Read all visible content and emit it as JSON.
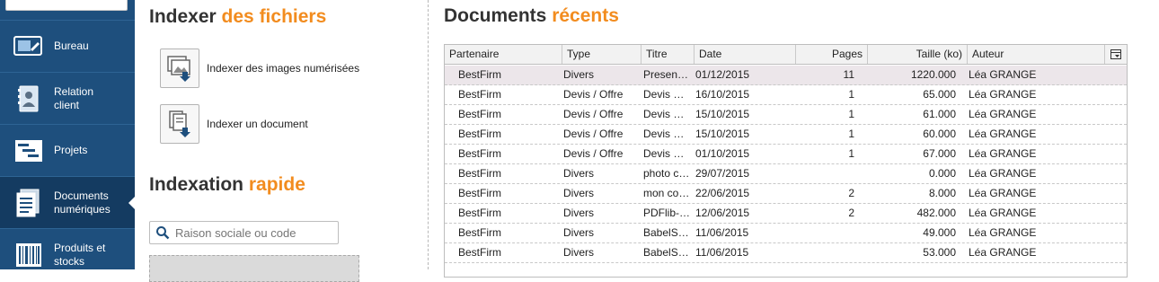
{
  "sidebar": {
    "items": [
      {
        "label": "Bureau",
        "icon": "desktop-icon"
      },
      {
        "label": "Relation\nclient",
        "icon": "contact-book-icon"
      },
      {
        "label": "Projets",
        "icon": "gantt-chart-icon"
      },
      {
        "label": "Documents\nnumériques",
        "icon": "document-icon",
        "active": true
      },
      {
        "label": "Produits et\nstocks",
        "icon": "barcode-icon"
      }
    ]
  },
  "indexer": {
    "title_main": "Indexer",
    "title_accent": "des fichiers",
    "actions": [
      {
        "label": "Indexer des images numérisées",
        "icon": "scan-images-icon"
      },
      {
        "label": "Indexer un document",
        "icon": "index-document-icon"
      }
    ]
  },
  "quick": {
    "title_main": "Indexation",
    "title_accent": "rapide",
    "search_placeholder": "Raison sociale ou code"
  },
  "recent": {
    "title_main": "Documents",
    "title_accent": "récents",
    "columns": [
      "Partenaire",
      "Type",
      "Titre",
      "Date",
      "Pages",
      "Taille (ko)",
      "Auteur"
    ],
    "rows": [
      {
        "partenaire": "BestFirm",
        "type": "Divers",
        "titre": "Presen…",
        "date": "01/12/2015",
        "pages": "11",
        "taille": "1220.000",
        "auteur": "Léa GRANGE"
      },
      {
        "partenaire": "BestFirm",
        "type": "Devis / Offre",
        "titre": "Devis …",
        "date": "16/10/2015",
        "pages": "1",
        "taille": "65.000",
        "auteur": "Léa GRANGE"
      },
      {
        "partenaire": "BestFirm",
        "type": "Devis / Offre",
        "titre": "Devis …",
        "date": "15/10/2015",
        "pages": "1",
        "taille": "61.000",
        "auteur": "Léa GRANGE"
      },
      {
        "partenaire": "BestFirm",
        "type": "Devis / Offre",
        "titre": "Devis …",
        "date": "15/10/2015",
        "pages": "1",
        "taille": "60.000",
        "auteur": "Léa GRANGE"
      },
      {
        "partenaire": "BestFirm",
        "type": "Devis / Offre",
        "titre": "Devis …",
        "date": "01/10/2015",
        "pages": "1",
        "taille": "67.000",
        "auteur": "Léa GRANGE"
      },
      {
        "partenaire": "BestFirm",
        "type": "Divers",
        "titre": "photo c…",
        "date": "29/07/2015",
        "pages": "",
        "taille": "0.000",
        "auteur": "Léa GRANGE"
      },
      {
        "partenaire": "BestFirm",
        "type": "Divers",
        "titre": "mon co…",
        "date": "22/06/2015",
        "pages": "2",
        "taille": "8.000",
        "auteur": "Léa GRANGE"
      },
      {
        "partenaire": "BestFirm",
        "type": "Divers",
        "titre": "PDFlib-…",
        "date": "12/06/2015",
        "pages": "2",
        "taille": "482.000",
        "auteur": "Léa GRANGE"
      },
      {
        "partenaire": "BestFirm",
        "type": "Divers",
        "titre": "BabelS…",
        "date": "11/06/2015",
        "pages": "",
        "taille": "49.000",
        "auteur": "Léa GRANGE"
      },
      {
        "partenaire": "BestFirm",
        "type": "Divers",
        "titre": "BabelS…",
        "date": "11/06/2015",
        "pages": "",
        "taille": "53.000",
        "auteur": "Léa GRANGE"
      }
    ]
  },
  "colors": {
    "sidebar": "#1e4f7d",
    "sidebar_active": "#143b61",
    "accent": "#f28c1f",
    "selected_row": "#ece6ea"
  }
}
